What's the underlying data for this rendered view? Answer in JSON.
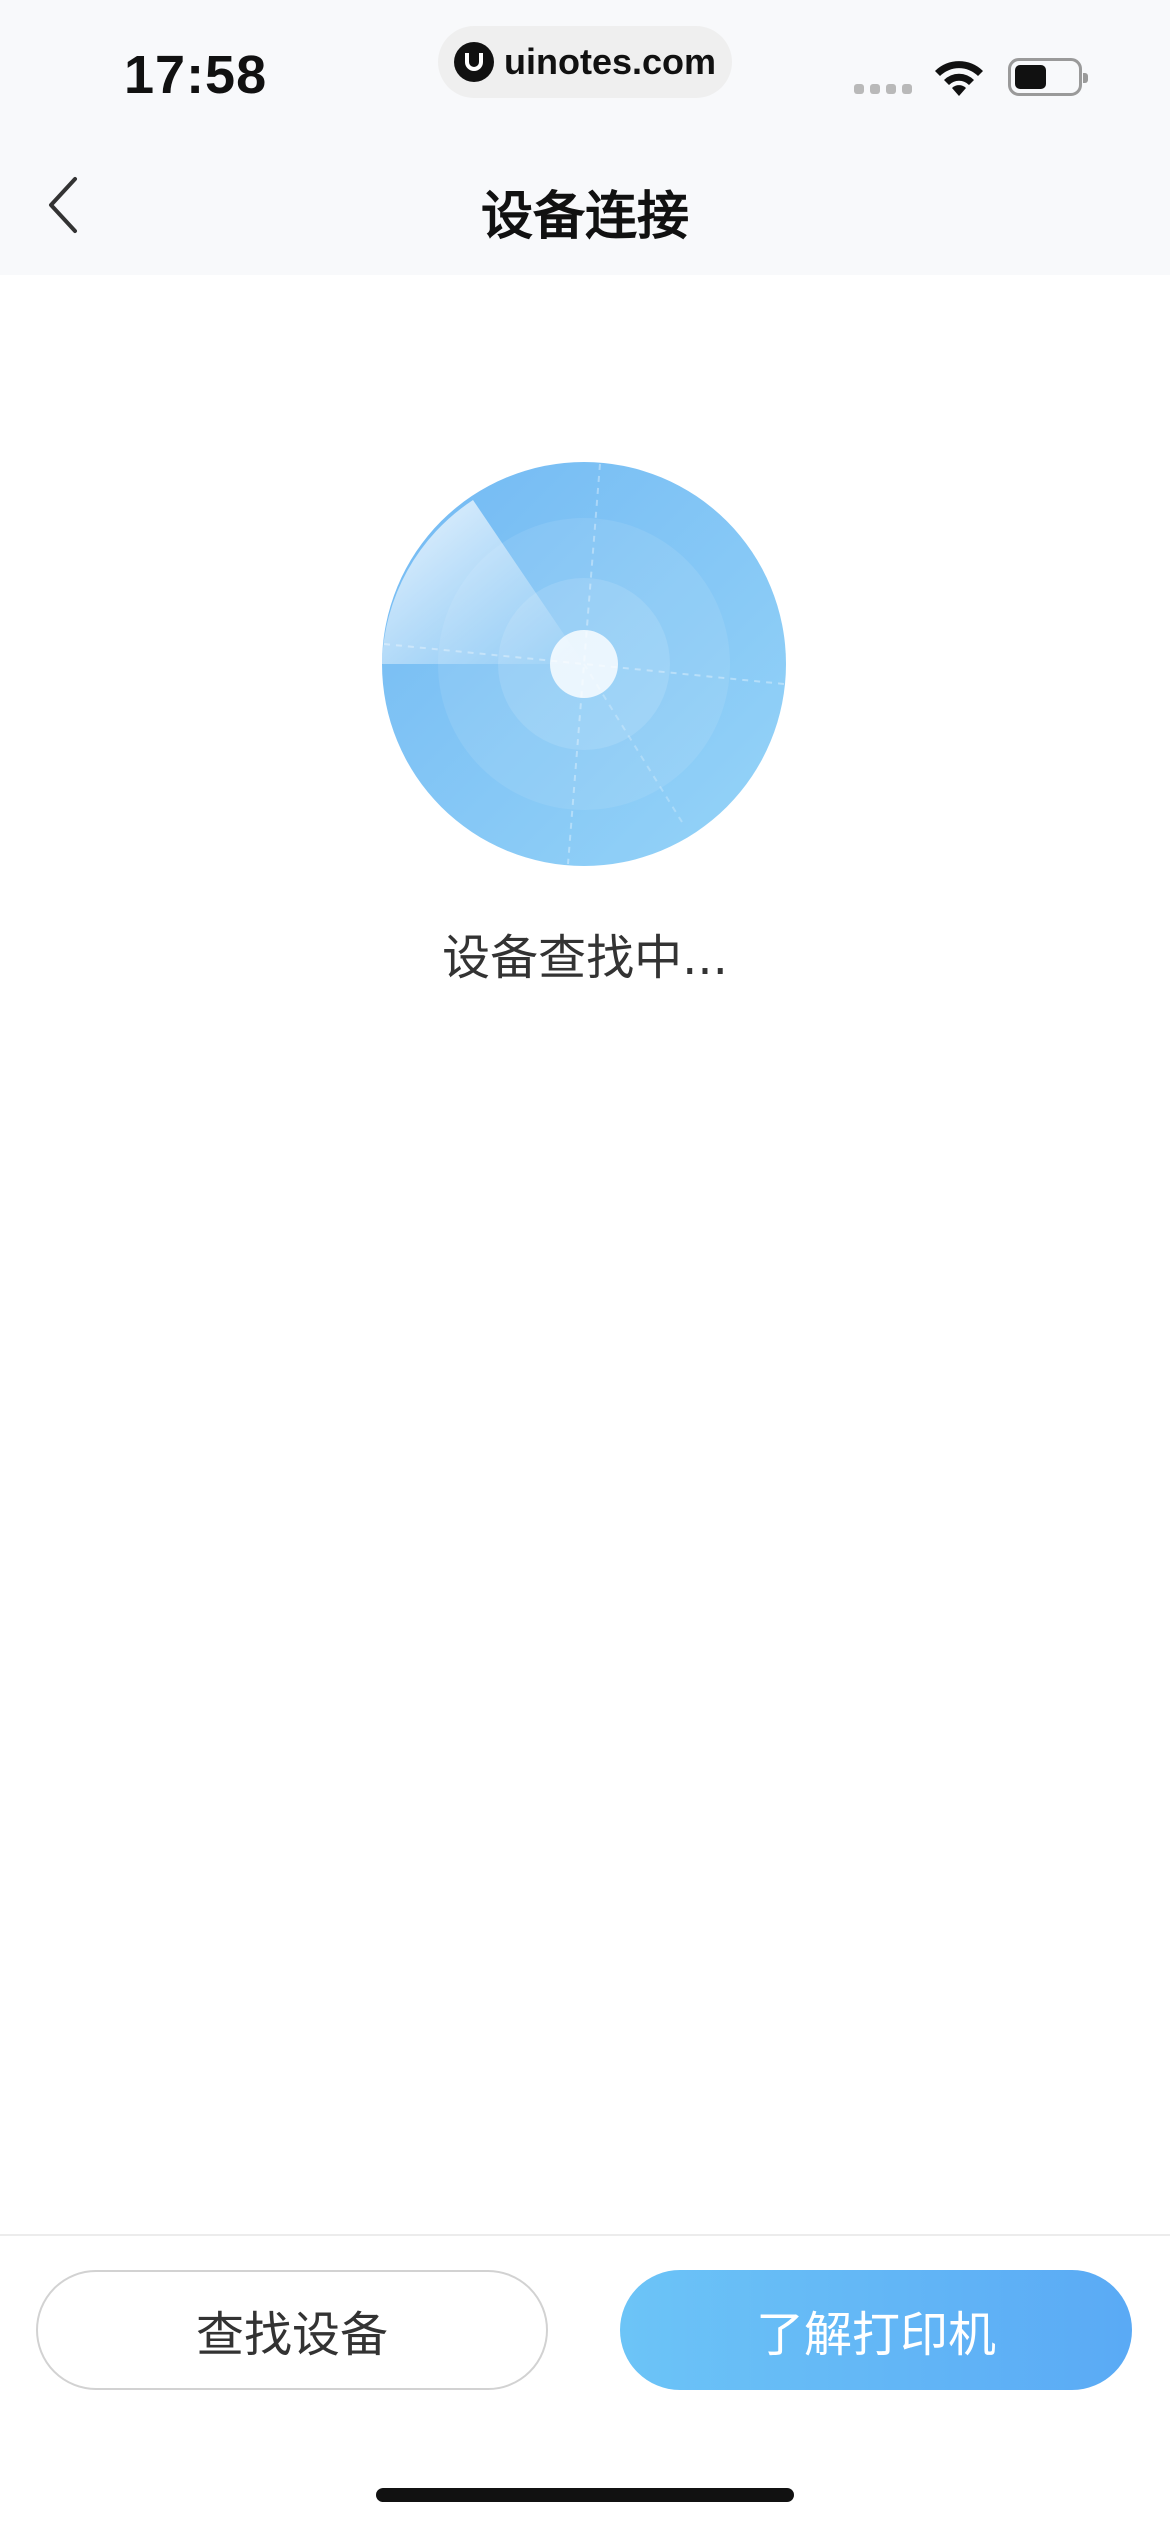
{
  "status_bar": {
    "time": "17:58",
    "url": "uinotes.com",
    "icons": [
      "signal-icon",
      "wifi-icon",
      "battery-icon"
    ]
  },
  "nav": {
    "title": "设备连接",
    "back_icon": "chevron-left-icon"
  },
  "main": {
    "radar_icon": "radar-scan-icon",
    "status_text": "设备查找中..."
  },
  "footer": {
    "find_label": "查找设备",
    "learn_label": "了解打印机"
  },
  "colors": {
    "accent": "#5aaaf5",
    "accent_light": "#6cc4f7",
    "radar": "#8ecdf7"
  }
}
